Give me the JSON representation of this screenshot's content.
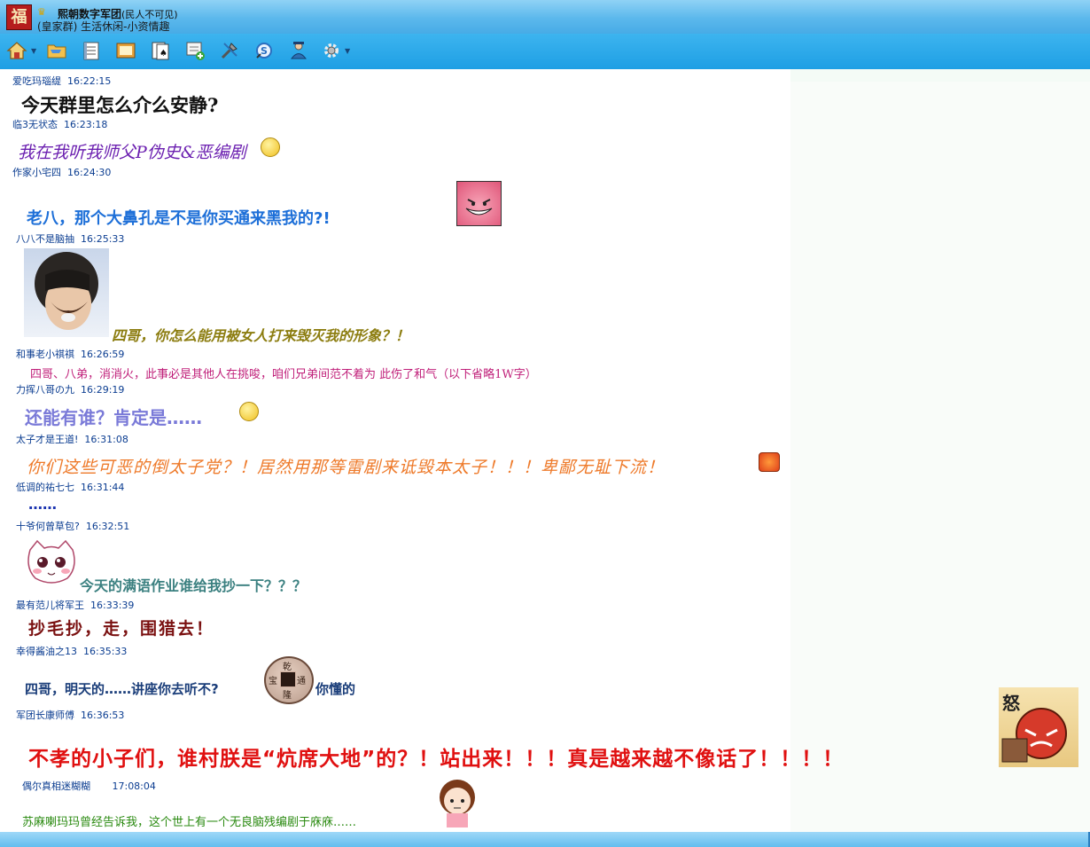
{
  "window": {
    "logo_glyph": "福",
    "title": "熙朝数字军团",
    "title_suffix": "(民人不可见)",
    "subtitle": "(皇家群) 生活休闲-小资情趣"
  },
  "toolbar": {
    "icons": [
      "home-icon",
      "folder-icon",
      "notes-icon",
      "album-icon",
      "cards-game-icon",
      "add-member-icon",
      "tools-icon",
      "search-icon",
      "manage-icon",
      "settings-icon"
    ]
  },
  "messages": [
    {
      "sender": "爱吃玛瑙缇",
      "time": "16:22:15",
      "text": "今天群里怎么介么安静?"
    },
    {
      "sender": "临3无状态",
      "time": "16:23:18",
      "text": "我在我听我师父P伪史&恶编剧"
    },
    {
      "sender": "作家小宅四",
      "time": "16:24:30",
      "text": "老八，那个大鼻孔是不是你买通来黑我的?!"
    },
    {
      "sender": "八八不是脑抽",
      "time": "16:25:33",
      "text": "四哥，你怎么能用被女人打来毁灭我的形象？！"
    },
    {
      "sender": "和事老小祺祺",
      "time": "16:26:59",
      "text": "四哥、八弟，消消火，此事必是其他人在挑唆，咱们兄弟间范不着为 此伤了和气（以下省略1W字）"
    },
    {
      "sender": "力挥八哥の九",
      "time": "16:29:19",
      "text": "还能有谁？肯定是……"
    },
    {
      "sender": "太子才是王道!",
      "time": "16:31:08",
      "text": "你们这些可恶的倒太子党？！居然用那等雷剧来诋毁本太子！！！卑鄙无耻下流！"
    },
    {
      "sender": "低调的祐七七",
      "time": "16:31:44",
      "text": "……"
    },
    {
      "sender": "十爷何曾草包?",
      "time": "16:32:51",
      "text": "今天的满语作业谁给我抄一下？？？"
    },
    {
      "sender": "最有范儿将军王",
      "time": "16:33:39",
      "text": "抄毛抄，走，围猎去！"
    },
    {
      "sender": "幸得酱油之13",
      "time": "16:35:33",
      "text": "四哥，明天的……讲座你去听不?",
      "text2": "你懂的"
    },
    {
      "sender": "军团长康师傅",
      "time": "16:36:53",
      "text": "不孝的小子们，谁村朕是“炕席大地”的？！站出来！！！真是越来越不像话了！！！！"
    },
    {
      "sender": "偶尔真相迷糊糊",
      "time": "17:08:04",
      "text": "苏麻喇玛玛曾经告诉我，这个世上有一个无良脑残编剧于庥庥……"
    }
  ],
  "stickers": {
    "coin_glyphs": [
      "乾",
      "隆",
      "通",
      "宝"
    ],
    "anger_glyph": "怒"
  },
  "colors": {
    "toolbar_bg": "#1e9fe4",
    "meta_text": "#0b3d91"
  }
}
